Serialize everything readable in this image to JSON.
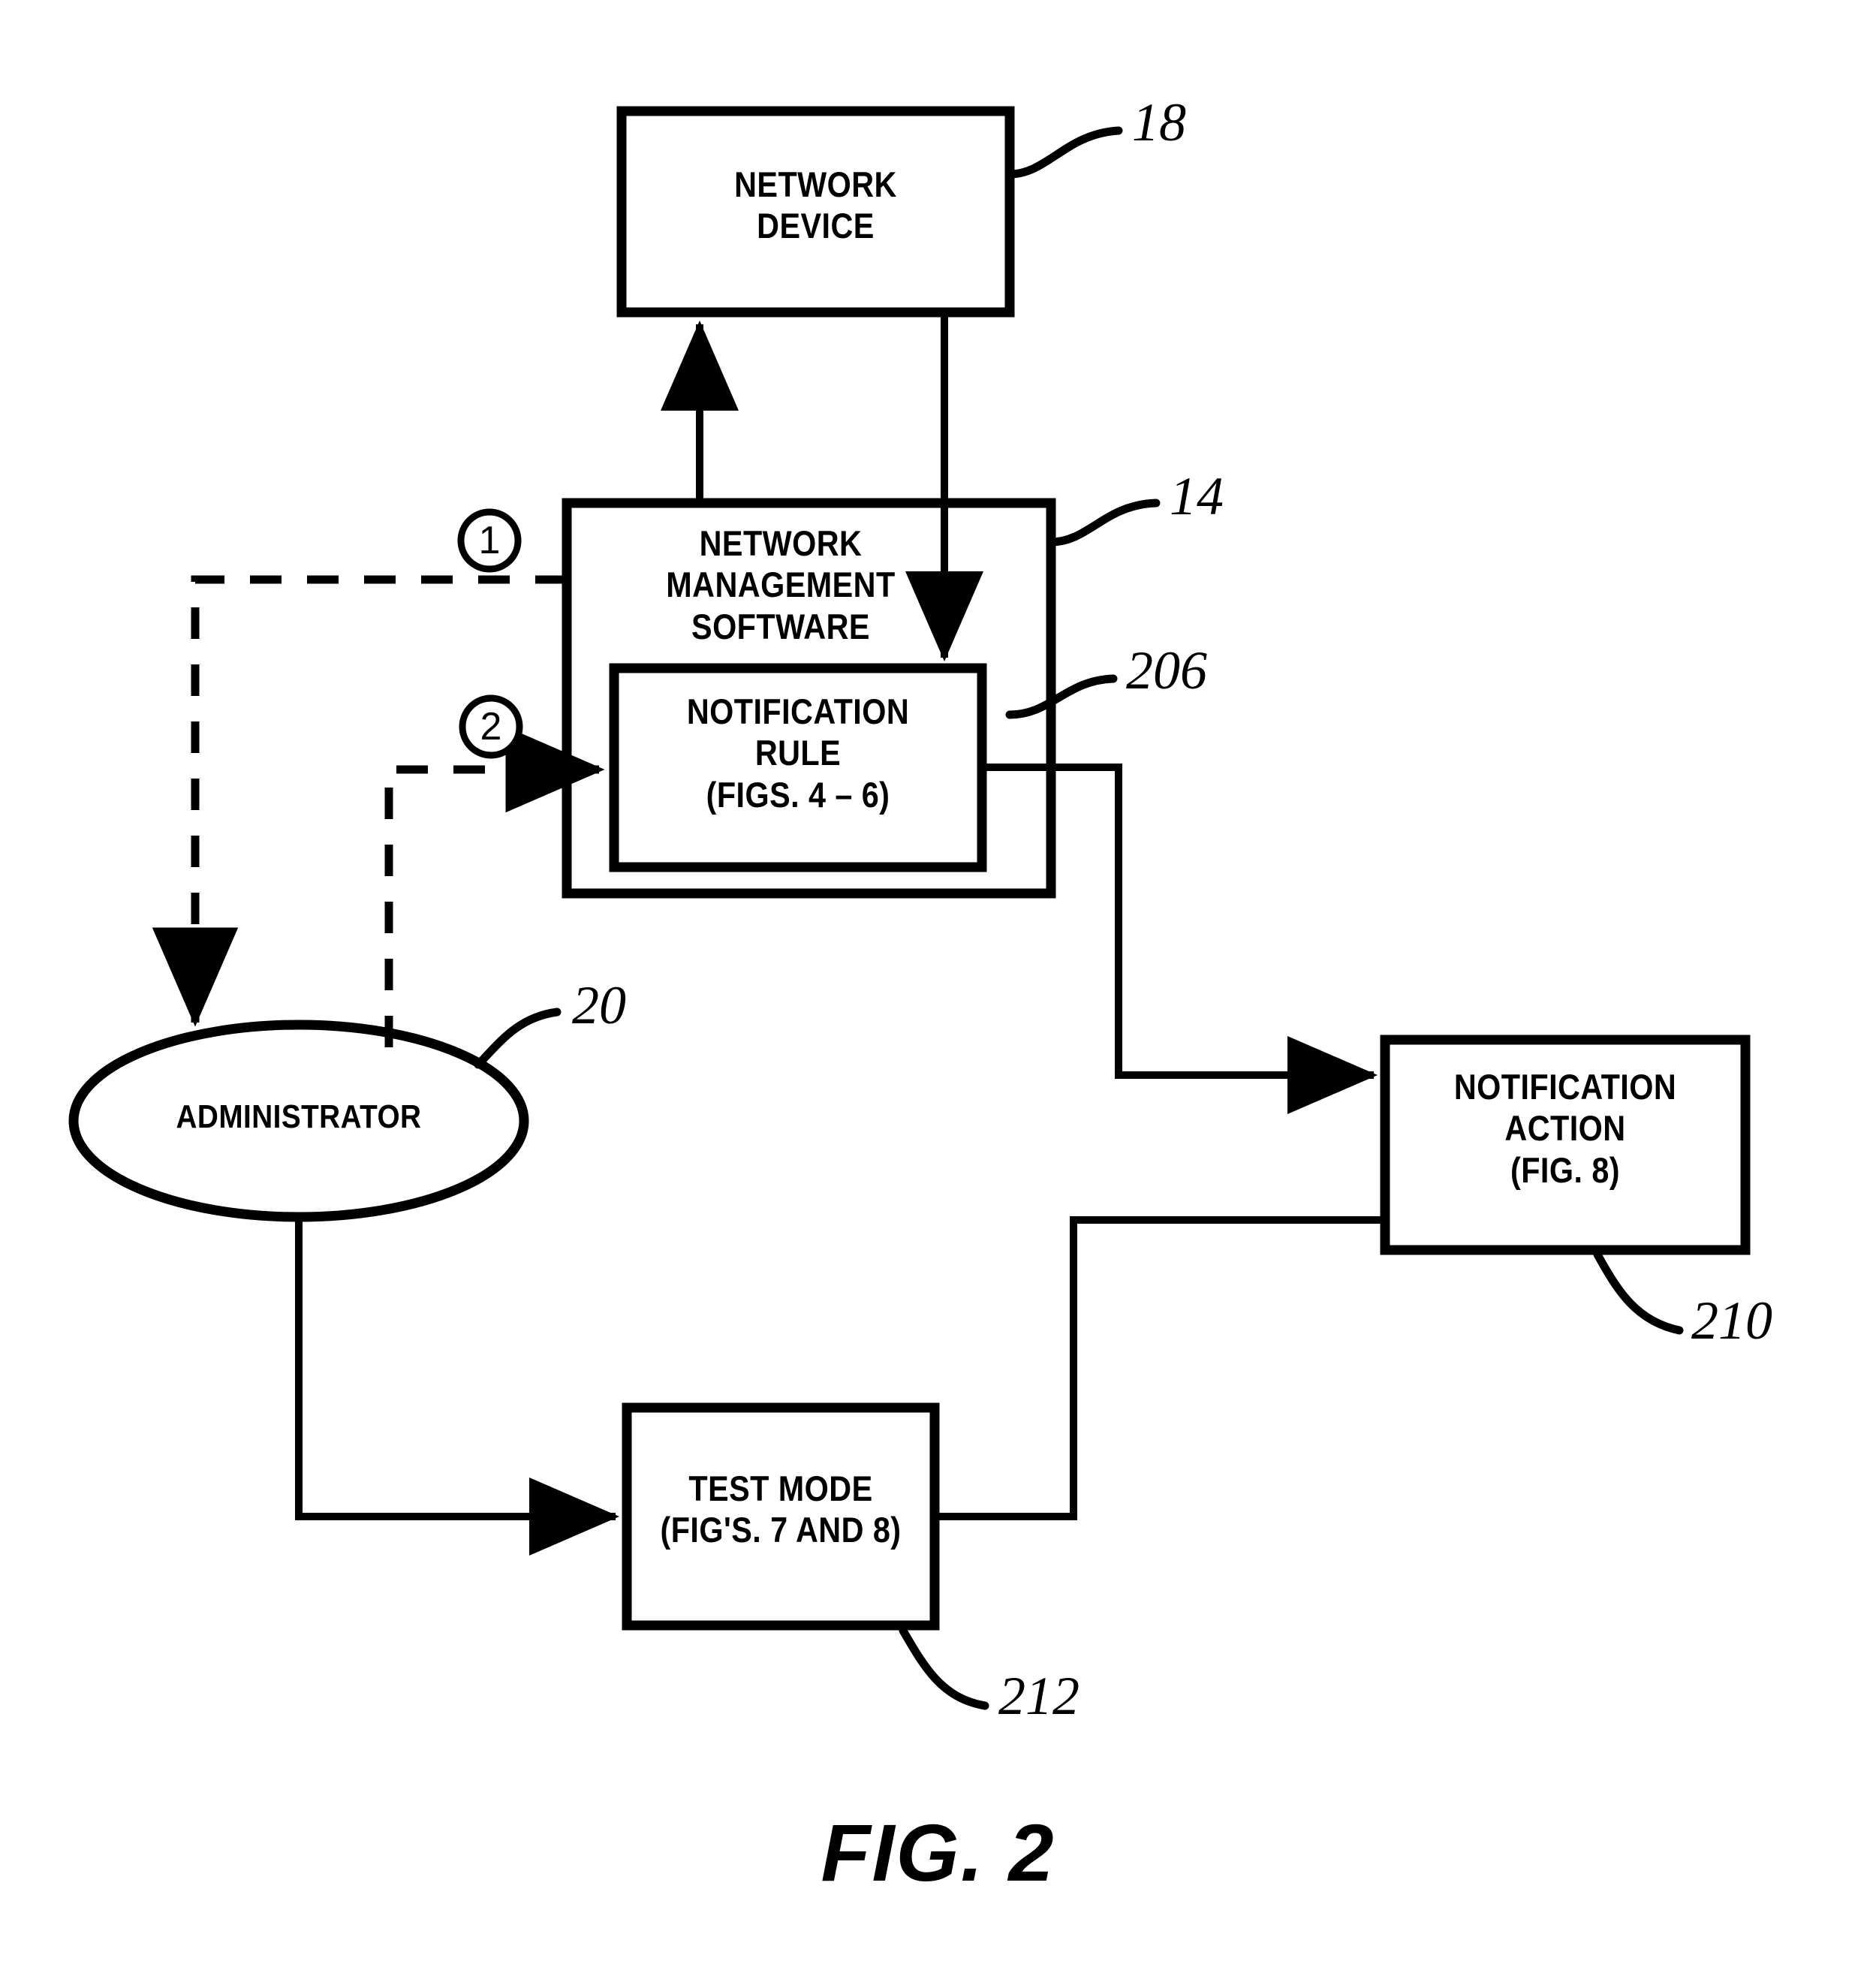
{
  "figure": {
    "caption": "FIG. 2",
    "type": "patent-block-diagram"
  },
  "nodes": {
    "network_device": {
      "label": "NETWORK\nDEVICE",
      "ref": "18",
      "shape": "rectangle"
    },
    "network_management_software": {
      "label": "NETWORK\nMANAGEMENT\nSOFTWARE",
      "ref": "14",
      "shape": "rectangle"
    },
    "notification_rule": {
      "label": "NOTIFICATION\nRULE\n(FIGS. 4 – 6)",
      "ref": "206",
      "shape": "rectangle"
    },
    "administrator": {
      "label": "ADMINISTRATOR",
      "ref": "20",
      "shape": "ellipse"
    },
    "notification_action": {
      "label": "NOTIFICATION\nACTION\n(FIG. 8)",
      "ref": "210",
      "shape": "rectangle"
    },
    "test_mode": {
      "label": "TEST MODE\n(FIG'S. 7 AND 8)",
      "ref": "212",
      "shape": "rectangle"
    }
  },
  "step_markers": {
    "step_one": "1",
    "step_two": "2"
  },
  "colors": {
    "ink": "#000000",
    "paper": "#ffffff"
  }
}
